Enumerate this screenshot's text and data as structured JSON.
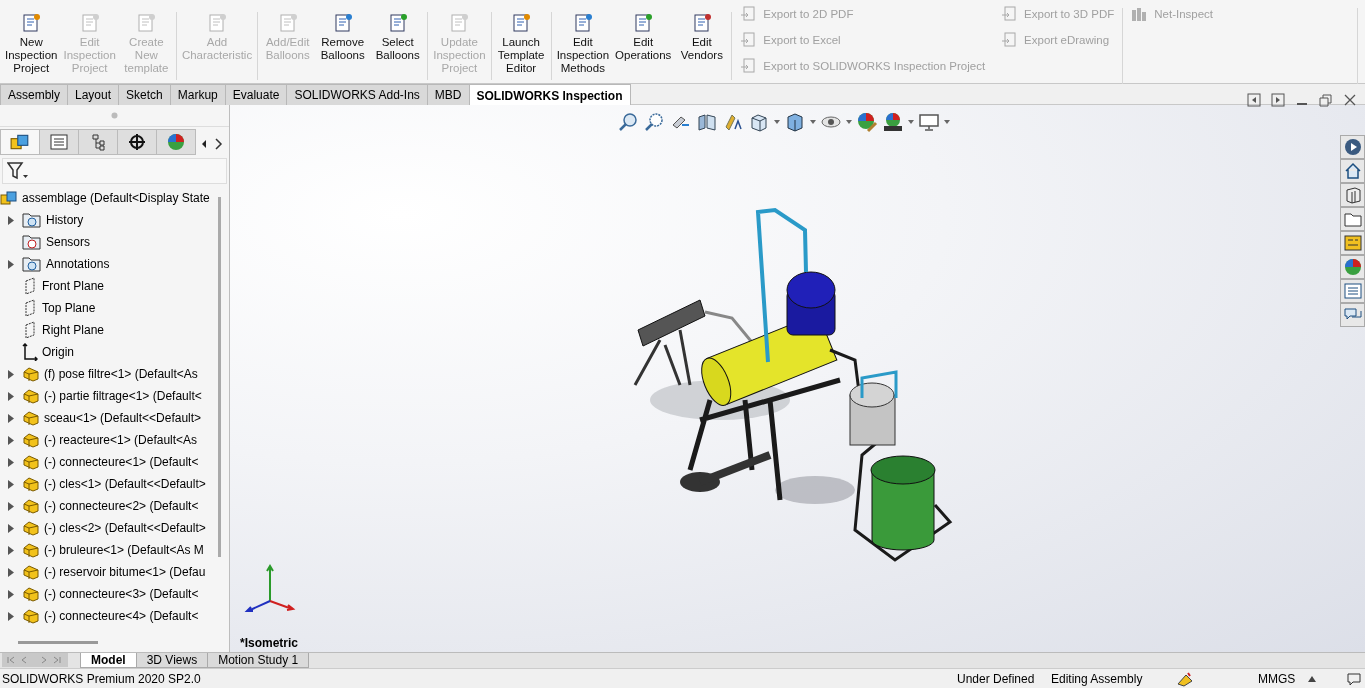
{
  "ribbon": {
    "groups": [
      {
        "buttons": [
          {
            "label": "New\nInspection\nProject",
            "disabled": false
          },
          {
            "label": "Edit\nInspection\nProject",
            "disabled": true
          },
          {
            "label": "Create\nNew\ntemplate",
            "disabled": true
          }
        ]
      },
      {
        "buttons": [
          {
            "label": "Add\nCharacteristic",
            "disabled": true
          }
        ]
      },
      {
        "buttons": [
          {
            "label": "Add/Edit\nBalloons",
            "disabled": true
          },
          {
            "label": "Remove\nBalloons",
            "disabled": false
          },
          {
            "label": "Select\nBalloons",
            "disabled": false
          }
        ]
      },
      {
        "buttons": [
          {
            "label": "Update\nInspection\nProject",
            "disabled": true
          }
        ]
      },
      {
        "buttons": [
          {
            "label": "Launch\nTemplate\nEditor",
            "disabled": false
          }
        ]
      },
      {
        "buttons": [
          {
            "label": "Edit\nInspection\nMethods",
            "disabled": false
          },
          {
            "label": "Edit\nOperations",
            "disabled": false
          },
          {
            "label": "Edit\nVendors",
            "disabled": false
          }
        ]
      }
    ],
    "exports": [
      {
        "items": [
          {
            "label": "Export to 2D PDF",
            "disabled": true
          },
          {
            "label": "Export to Excel",
            "disabled": true
          },
          {
            "label": "Export to SOLIDWORKS Inspection Project",
            "disabled": true
          }
        ]
      },
      {
        "items": [
          {
            "label": "Export to 3D PDF",
            "disabled": true
          },
          {
            "label": "Export eDrawing",
            "disabled": true
          }
        ]
      },
      {
        "items": [
          {
            "label": "Net-Inspect",
            "disabled": true
          }
        ]
      }
    ]
  },
  "tabs": [
    {
      "label": "Assembly",
      "selected": false
    },
    {
      "label": "Layout",
      "selected": false
    },
    {
      "label": "Sketch",
      "selected": false
    },
    {
      "label": "Markup",
      "selected": false
    },
    {
      "label": "Evaluate",
      "selected": false
    },
    {
      "label": "SOLIDWORKS Add-Ins",
      "selected": false
    },
    {
      "label": "MBD",
      "selected": false
    },
    {
      "label": "SOLIDWORKS Inspection",
      "selected": true
    }
  ],
  "manager_tabs": [
    {
      "selected": true
    },
    {
      "selected": false
    },
    {
      "selected": false
    },
    {
      "selected": false
    },
    {
      "selected": false
    }
  ],
  "tree": {
    "label": "assemblage (Default<Display State",
    "kind": "assembly",
    "children": [
      {
        "label": "History",
        "kind": "history",
        "expanded": false
      },
      {
        "label": "Sensors",
        "kind": "sensors"
      },
      {
        "label": "Annotations",
        "kind": "annotations",
        "expanded": false
      },
      {
        "label": "Front Plane",
        "kind": "plane"
      },
      {
        "label": "Top Plane",
        "kind": "plane"
      },
      {
        "label": "Right Plane",
        "kind": "plane"
      },
      {
        "label": "Origin",
        "kind": "origin"
      },
      {
        "label": "(f) pose filtre<1> (Default<As",
        "kind": "component",
        "expanded": false
      },
      {
        "label": "(-) partie filtrage<1> (Default<",
        "kind": "component",
        "expanded": false
      },
      {
        "label": "sceau<1> (Default<<Default>",
        "kind": "component",
        "expanded": false
      },
      {
        "label": "(-) reacteure<1> (Default<As",
        "kind": "component",
        "expanded": false
      },
      {
        "label": "(-) connecteure<1> (Default<",
        "kind": "component",
        "expanded": false
      },
      {
        "label": "(-) cles<1> (Default<<Default>",
        "kind": "component",
        "expanded": false
      },
      {
        "label": "(-) connecteure<2> (Default<",
        "kind": "component",
        "expanded": false
      },
      {
        "label": "(-) cles<2> (Default<<Default>",
        "kind": "component",
        "expanded": false
      },
      {
        "label": "(-) bruleure<1> (Default<As M",
        "kind": "component",
        "expanded": false
      },
      {
        "label": "(-) reservoir bitume<1> (Defau",
        "kind": "component",
        "expanded": false
      },
      {
        "label": "(-) connecteure<3> (Default<",
        "kind": "component",
        "expanded": false
      },
      {
        "label": "(-) connecteure<4> (Default<",
        "kind": "component",
        "expanded": false
      }
    ]
  },
  "viewport": {
    "view_name": "*Isometric"
  },
  "bottom_tabs": [
    {
      "label": "Model",
      "selected": true
    },
    {
      "label": "3D Views",
      "selected": false
    },
    {
      "label": "Motion Study 1",
      "selected": false
    }
  ],
  "status_bar": {
    "product": "SOLIDWORKS Premium 2020 SP2.0",
    "state": "Under Defined",
    "mode": "Editing Assembly",
    "units": "MMGS"
  }
}
